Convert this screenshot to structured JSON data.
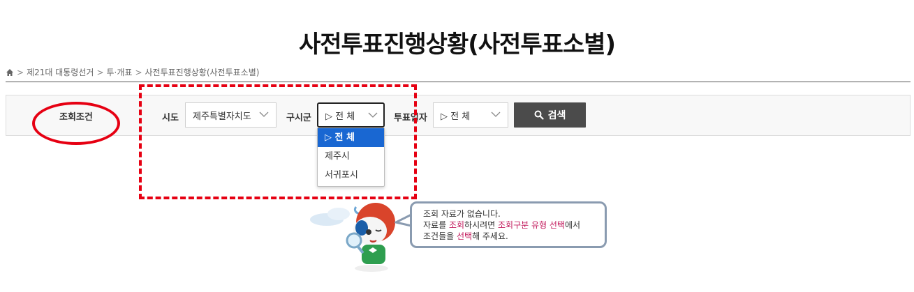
{
  "page": {
    "title": "사전투표진행상황(사전투표소별)"
  },
  "breadcrumb": {
    "sep": ">",
    "items": [
      "제21대 대통령선거",
      "투·개표",
      "사전투표진행상황(사전투표소별)"
    ]
  },
  "search": {
    "condition_label": "조회조건",
    "sido": {
      "label": "시도",
      "value": "제주특별자치도"
    },
    "gusigun": {
      "label": "구시군",
      "value": "▷ 전 체"
    },
    "vote_date": {
      "label": "투표일자",
      "value": "▷ 전 체"
    },
    "button_label": "검색",
    "dropdown_options": [
      "▷ 전 체",
      "제주시",
      "서귀포시"
    ]
  },
  "message": {
    "line1": "조회 자료가 없습니다.",
    "line2_a": "자료를 ",
    "line2_b": "조회",
    "line2_c": "하시려면 ",
    "line2_d": "조회구분 유형 선택",
    "line2_e": "에서",
    "line3_a": "조건들을 ",
    "line3_b": "선택",
    "line3_c": "해 주세요."
  },
  "colors": {
    "annotation_red": "#e60012",
    "highlight_pink": "#c2185b",
    "selected_blue": "#1967d2",
    "button_dark": "#4b4b4b"
  }
}
